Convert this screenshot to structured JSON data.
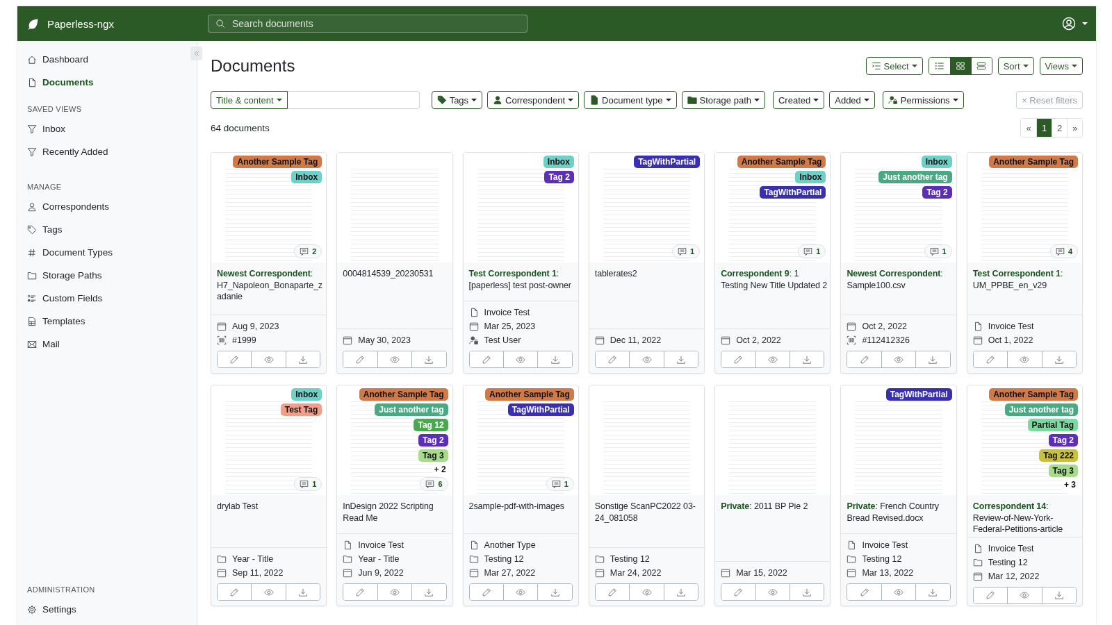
{
  "app": {
    "name": "Paperless-ngx"
  },
  "search": {
    "placeholder": "Search documents"
  },
  "sidebar": {
    "nav": [
      {
        "label": "Dashboard",
        "kind": "dashboard",
        "selected": false
      },
      {
        "label": "Documents",
        "kind": "documents",
        "selected": true
      }
    ],
    "sections": [
      {
        "heading": "SAVED VIEWS",
        "items": [
          {
            "label": "Inbox",
            "kind": "view",
            "selected": false
          },
          {
            "label": "Recently Added",
            "kind": "view",
            "selected": false
          }
        ]
      },
      {
        "heading": "MANAGE",
        "items": [
          {
            "label": "Correspondents",
            "kind": "correspondents",
            "selected": false
          },
          {
            "label": "Tags",
            "kind": "tags",
            "selected": false
          },
          {
            "label": "Document Types",
            "kind": "document_types",
            "selected": false
          },
          {
            "label": "Storage Paths",
            "kind": "storage_paths",
            "selected": false
          },
          {
            "label": "Custom Fields",
            "kind": "custom_fields",
            "selected": false
          },
          {
            "label": "Templates",
            "kind": "templates",
            "selected": false
          },
          {
            "label": "Mail",
            "kind": "mail",
            "selected": false
          }
        ]
      },
      {
        "heading": "ADMINISTRATION",
        "items": [
          {
            "label": "Settings",
            "kind": "settings",
            "selected": false
          }
        ]
      }
    ]
  },
  "page": {
    "title": "Documents",
    "select_label": "Select",
    "sort_label": "Sort",
    "views_label": "Views",
    "view_modes": [
      {
        "kind": "list",
        "selected": false
      },
      {
        "kind": "grid",
        "selected": true
      },
      {
        "kind": "rows",
        "selected": false
      }
    ]
  },
  "filters": {
    "text_mode": "Title & content",
    "dropdowns": [
      {
        "label": "Tags",
        "kind": "tags"
      },
      {
        "label": "Correspondent",
        "kind": "correspondent"
      },
      {
        "label": "Document type",
        "kind": "document_type"
      },
      {
        "label": "Storage path",
        "kind": "storage_path"
      },
      {
        "label": "Created",
        "kind": "created"
      },
      {
        "label": "Added",
        "kind": "added"
      },
      {
        "label": "Permissions",
        "kind": "permissions"
      }
    ],
    "reset": {
      "label": "× Reset filters",
      "disabled": true
    }
  },
  "count": "64 documents",
  "pagination": [
    {
      "label": "«",
      "selected": false
    },
    {
      "label": "1",
      "selected": true
    },
    {
      "label": "2",
      "selected": false
    },
    {
      "label": "»",
      "selected": false
    }
  ],
  "cards": [
    {
      "tags": [
        {
          "name": "Another Sample Tag",
          "color": "#d07a4a"
        },
        {
          "name": "Inbox",
          "color": "#6fd0c8"
        }
      ],
      "notes": "2",
      "title": "**Newest Correspondent**: H7_Napoleon_Bonaparte_zadanie",
      "meta": [
        {
          "kind": "created",
          "text": "Aug 9, 2023"
        },
        {
          "kind": "asn",
          "text": "#1999"
        }
      ]
    },
    {
      "title": "0004814539_20230531",
      "meta": [
        {
          "kind": "created",
          "text": "May 30, 2023"
        }
      ]
    },
    {
      "tags": [
        {
          "name": "Inbox",
          "color": "#6fd0c8"
        },
        {
          "name": "Tag 2",
          "color": "#5b2fb8"
        }
      ],
      "title": "**Test Correspondent 1**: [paperless] test post-owner",
      "meta": [
        {
          "kind": "document_type",
          "text": "Invoice Test"
        },
        {
          "kind": "created",
          "text": "Mar 25, 2023"
        },
        {
          "kind": "owner",
          "text": "Test User"
        }
      ]
    },
    {
      "tags": [
        {
          "name": "TagWithPartial",
          "color": "#3a2fb0"
        }
      ],
      "notes": "1",
      "title": "tablerates2",
      "meta": [
        {
          "kind": "created",
          "text": "Dec 11, 2022"
        }
      ]
    },
    {
      "tags": [
        {
          "name": "Another Sample Tag",
          "color": "#d07a4a"
        },
        {
          "name": "Inbox",
          "color": "#6fd0c8"
        },
        {
          "name": "TagWithPartial",
          "color": "#3a2fb0"
        }
      ],
      "notes": "1",
      "title": "**Correspondent 9**: 1 Testing New Title Updated 2",
      "meta": [
        {
          "kind": "created",
          "text": "Oct 2, 2022"
        }
      ]
    },
    {
      "tags": [
        {
          "name": "Inbox",
          "color": "#6fd0c8"
        },
        {
          "name": "Just another tag",
          "color": "#4aa883"
        },
        {
          "name": "Tag 2",
          "color": "#5b2fb8"
        }
      ],
      "notes": "1",
      "title": "**Newest Correspondent**: Sample100.csv",
      "meta": [
        {
          "kind": "created",
          "text": "Oct 2, 2022"
        },
        {
          "kind": "asn",
          "text": "#112412326"
        }
      ]
    },
    {
      "tags": [
        {
          "name": "Another Sample Tag",
          "color": "#d07a4a"
        }
      ],
      "notes": "4",
      "title": "**Test Correspondent 1**: UM_PPBE_en_v29",
      "meta": [
        {
          "kind": "document_type",
          "text": "Invoice Test"
        },
        {
          "kind": "created",
          "text": "Oct 1, 2022"
        }
      ]
    },
    {
      "tags": [
        {
          "name": "Inbox",
          "color": "#6fd0c8"
        },
        {
          "name": "Test Tag",
          "color": "#f0a08a"
        }
      ],
      "notes": "1",
      "title": "drylab Test",
      "meta": [
        {
          "kind": "storage_path",
          "text": "Year - Title"
        },
        {
          "kind": "created",
          "text": "Sep 11, 2022"
        }
      ]
    },
    {
      "tags": [
        {
          "name": "Another Sample Tag",
          "color": "#d07a4a"
        },
        {
          "name": "Just another tag",
          "color": "#4aa883"
        },
        {
          "name": "Tag 12",
          "color": "#4aa84e"
        },
        {
          "name": "Tag 2",
          "color": "#5b2fb8"
        },
        {
          "name": "Tag 3",
          "color": "#a8dc8c"
        }
      ],
      "more": "+ 2",
      "notes": "6",
      "title": "InDesign 2022 Scripting Read Me",
      "meta": [
        {
          "kind": "document_type",
          "text": "Invoice Test"
        },
        {
          "kind": "storage_path",
          "text": "Year - Title"
        },
        {
          "kind": "created",
          "text": "Jun 9, 2022"
        }
      ]
    },
    {
      "tags": [
        {
          "name": "Another Sample Tag",
          "color": "#d07a4a"
        },
        {
          "name": "TagWithPartial",
          "color": "#3a2fb0"
        }
      ],
      "notes": "1",
      "title": "2sample-pdf-with-images",
      "meta": [
        {
          "kind": "document_type",
          "text": "Another Type"
        },
        {
          "kind": "storage_path",
          "text": "Testing 12"
        },
        {
          "kind": "created",
          "text": "Mar 27, 2022"
        }
      ]
    },
    {
      "title": "Sonstige ScanPC2022 03-24_081058",
      "meta": [
        {
          "kind": "storage_path",
          "text": "Testing 12"
        },
        {
          "kind": "created",
          "text": "Mar 24, 2022"
        }
      ]
    },
    {
      "title": "**Private**: 2011 BP Pie 2",
      "meta": [
        {
          "kind": "created",
          "text": "Mar 15, 2022"
        }
      ]
    },
    {
      "tags": [
        {
          "name": "TagWithPartial",
          "color": "#3a2fb0"
        }
      ],
      "title": "**Private**: French Country Bread Revised.docx",
      "meta": [
        {
          "kind": "document_type",
          "text": "Invoice Test"
        },
        {
          "kind": "storage_path",
          "text": "Testing 12"
        },
        {
          "kind": "created",
          "text": "Mar 13, 2022"
        }
      ]
    },
    {
      "tags": [
        {
          "name": "Another Sample Tag",
          "color": "#d07a4a"
        },
        {
          "name": "Just another tag",
          "color": "#4aa883"
        },
        {
          "name": "Partial Tag",
          "color": "#7ed8a0"
        },
        {
          "name": "Tag 2",
          "color": "#5b2fb8"
        },
        {
          "name": "Tag 222",
          "color": "#c9c040"
        },
        {
          "name": "Tag 3",
          "color": "#a8dc8c"
        }
      ],
      "more": "+ 3",
      "title": "**Correspondent 14**: Review-of-New-York-Federal-Petitions-article",
      "meta": [
        {
          "kind": "document_type",
          "text": "Invoice Test"
        },
        {
          "kind": "storage_path",
          "text": "Testing 12"
        },
        {
          "kind": "created",
          "text": "Mar 12, 2022"
        }
      ]
    }
  ]
}
